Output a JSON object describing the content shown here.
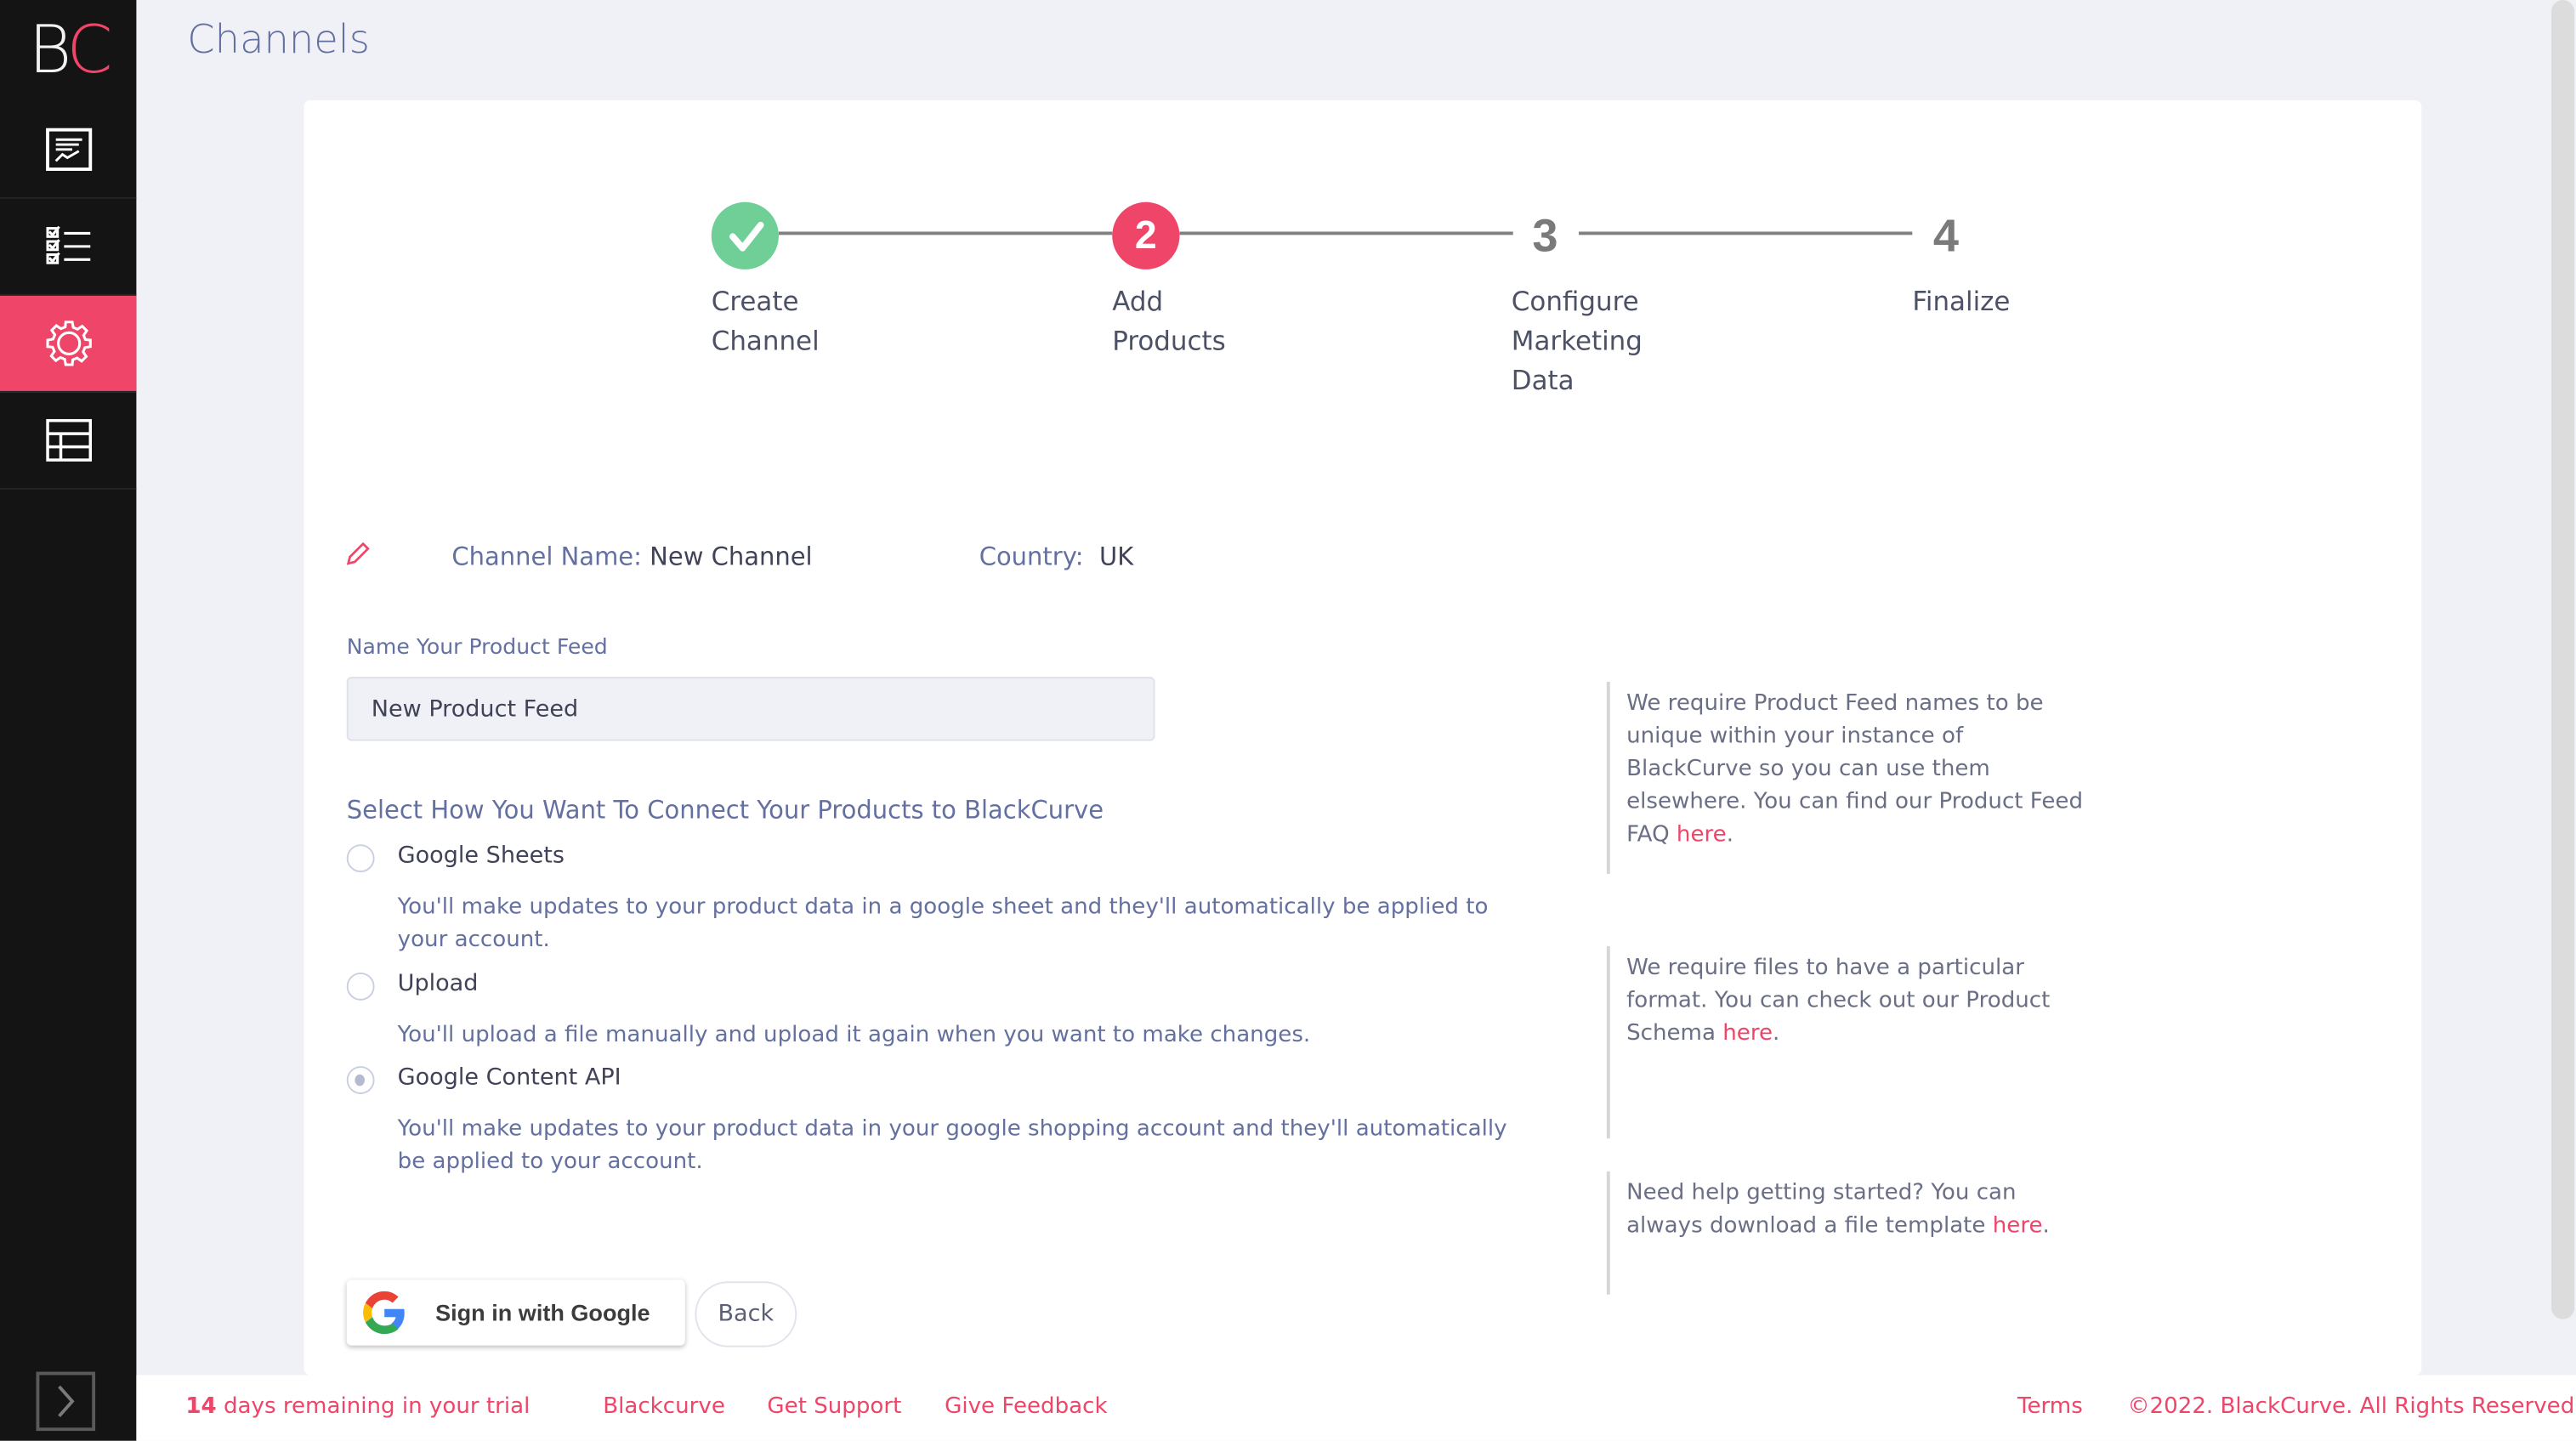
{
  "app": {
    "logo_b": "B",
    "logo_c": "C",
    "page_title": "Channels"
  },
  "sidebar": {
    "items": [
      {
        "name": "reports",
        "icon": "report-chart-icon",
        "active": false
      },
      {
        "name": "tasks",
        "icon": "checklist-icon",
        "active": false
      },
      {
        "name": "settings",
        "icon": "gear-icon",
        "active": true
      },
      {
        "name": "data-table",
        "icon": "table-icon",
        "active": false
      }
    ],
    "expand_icon": "chevron-right-icon"
  },
  "stepper": {
    "steps": [
      {
        "number": "1",
        "label": "Create Channel",
        "state": "complete"
      },
      {
        "number": "2",
        "label": "Add Products",
        "state": "active"
      },
      {
        "number": "3",
        "label": "Configure Marketing Data",
        "state": "pending"
      },
      {
        "number": "4",
        "label": "Finalize",
        "state": "pending"
      }
    ]
  },
  "channel": {
    "name_label": "Channel Name:",
    "name_value": "New Channel",
    "country_label": "Country:",
    "country_value": "UK"
  },
  "feed": {
    "label": "Name Your Product Feed",
    "value": "New Product Feed"
  },
  "connect": {
    "title": "Select How You Want To Connect Your Products to BlackCurve",
    "options": [
      {
        "label": "Google Sheets",
        "description": "You'll make updates to your product data in a google sheet and they'll automatically be applied to your account.",
        "checked": false
      },
      {
        "label": "Upload",
        "description": "You'll upload a file manually and upload it again when you want to make changes.",
        "checked": false
      },
      {
        "label": "Google Content API",
        "description": "You'll make updates to your product data in your google shopping account and they'll automatically be applied to your account.",
        "checked": true
      }
    ]
  },
  "help": [
    {
      "text": "We require Product Feed names to be unique within your instance of BlackCurve so you can use them elsewhere. You can find our Product Feed FAQ ",
      "link": "here",
      "tail": "."
    },
    {
      "text": "We require files to have a particular format. You can check out our Product Schema ",
      "link": "here",
      "tail": "."
    },
    {
      "text": "Need help getting started? You can always download a file template ",
      "link": "here",
      "tail": "."
    }
  ],
  "buttons": {
    "google_signin": "Sign in with Google",
    "back": "Back"
  },
  "footer": {
    "trial_days": "14",
    "trial_text": " days remaining in your trial",
    "links": [
      "Blackcurve",
      "Get Support",
      "Give Feedback"
    ],
    "terms": "Terms",
    "copyright": "©2022. BlackCurve. All Rights Reserved"
  },
  "colors": {
    "accent": "#ef4569",
    "success": "#6fcf97",
    "sidebar": "#141414",
    "text_muted": "#6470a0"
  }
}
